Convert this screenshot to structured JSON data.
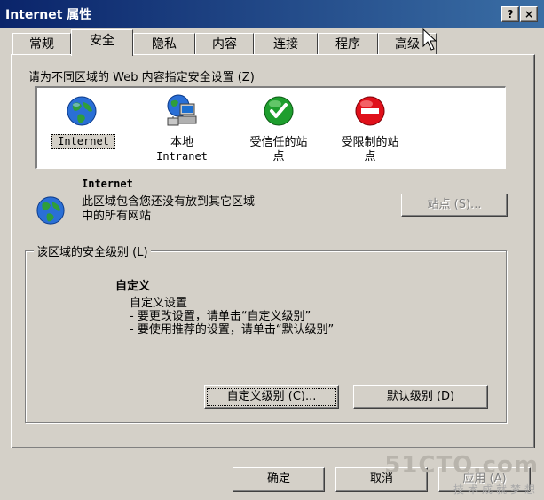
{
  "window": {
    "title": "Internet 属性",
    "help_label": "?",
    "close_label": "×"
  },
  "tabs": [
    {
      "label": "常规",
      "active": false
    },
    {
      "label": "安全",
      "active": true
    },
    {
      "label": "隐私",
      "active": false
    },
    {
      "label": "内容",
      "active": false
    },
    {
      "label": "连接",
      "active": false
    },
    {
      "label": "程序",
      "active": false
    },
    {
      "label": "高级",
      "active": false
    }
  ],
  "security": {
    "zone_prompt": "请为不同区域的 Web 内容指定安全设置 (Z)",
    "zones": [
      {
        "icon": "globe-icon",
        "label_line1": "Internet",
        "label_line2": ""
      },
      {
        "icon": "network-computer-icon",
        "label_line1": "本地",
        "label_line2": "Intranet"
      },
      {
        "icon": "check-circle-icon",
        "label_line1": "受信任的站",
        "label_line2": "点"
      },
      {
        "icon": "no-entry-icon",
        "label_line1": "受限制的站",
        "label_line2": "点"
      }
    ],
    "selected_zone_name": "Internet",
    "selected_zone_desc_line1": "此区域包含您还没有放到其它区域",
    "selected_zone_desc_line2": "中的所有网站",
    "sites_button": "站点 (S)...",
    "level_group_title": "该区域的安全级别 (L)",
    "level_name": "自定义",
    "level_desc_line1": "自定义设置",
    "level_desc_line2": "- 要更改设置，请单击“自定义级别”",
    "level_desc_line3": "- 要使用推荐的设置，请单击“默认级别”",
    "custom_level_button": "自定义级别 (C)...",
    "default_level_button": "默认级别 (D)"
  },
  "footer": {
    "ok_button": "确定",
    "cancel_button": "取消",
    "apply_button": "应用 (A)"
  },
  "watermark": {
    "brand": "51CTO.com",
    "slogan": "技术成就梦想"
  },
  "colors": {
    "titlebar_start": "#0a246a",
    "titlebar_end": "#3a6ea5",
    "face": "#d4d0c8",
    "trusted_green": "#1e9e2e",
    "restricted_red": "#e0101a"
  }
}
